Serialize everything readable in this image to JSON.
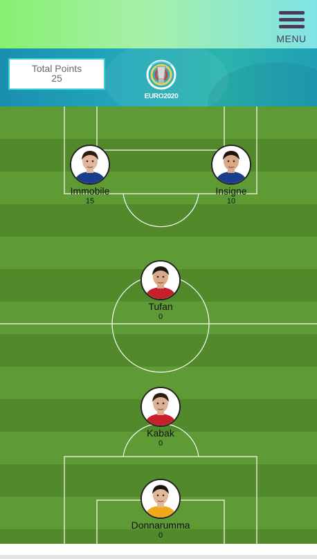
{
  "header": {
    "menu_label": "MENU",
    "menu_icon": "hamburger-icon"
  },
  "banner": {
    "total_points_label": "Total Points",
    "total_points_value": "25",
    "logo_text": "EURO2020",
    "logo_icon": "uefa-euro-trophy-logo"
  },
  "players": [
    {
      "name": "Immobile",
      "points": "15",
      "kit": "#1a3e8c",
      "skin": "#e3b79c",
      "hair": "#2a1c12"
    },
    {
      "name": "Insigne",
      "points": "10",
      "kit": "#1a3e8c",
      "skin": "#d9a886",
      "hair": "#1d1410"
    },
    {
      "name": "Tufan",
      "points": "0",
      "kit": "#c8202a",
      "skin": "#d8aa8a",
      "hair": "#1c140f"
    },
    {
      "name": "Kabak",
      "points": "0",
      "kit": "#c8202a",
      "skin": "#dcb194",
      "hair": "#2a1d14"
    },
    {
      "name": "Donnarumma",
      "points": "0",
      "kit": "#f2a81d",
      "skin": "#e1b89a",
      "hair": "#1b120c"
    }
  ],
  "colors": {
    "stripe_light": "#5e9b35",
    "stripe_dark": "#528a2b",
    "line": "#ffffff"
  }
}
